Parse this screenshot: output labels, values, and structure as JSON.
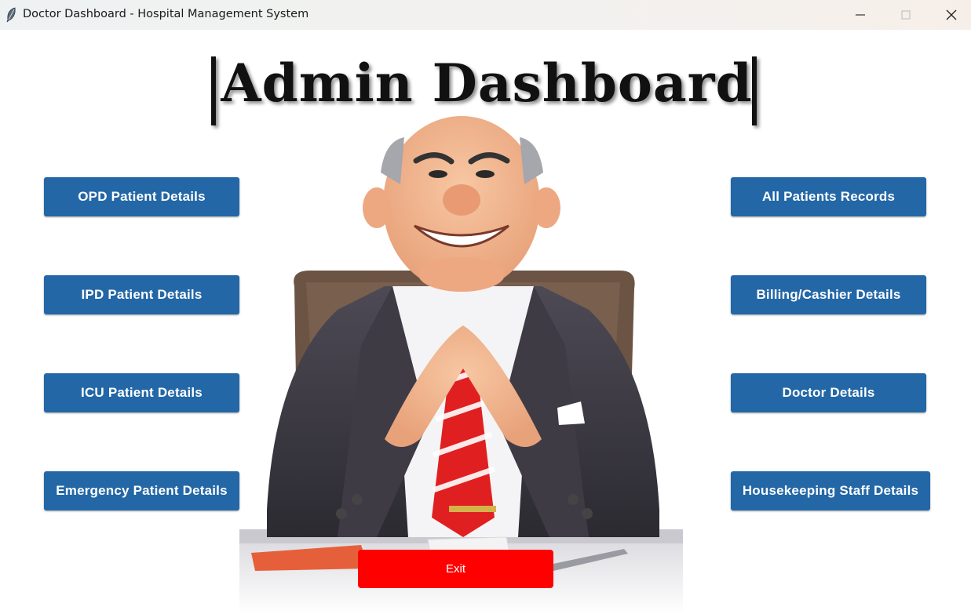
{
  "window": {
    "title": "Doctor Dashboard - Hospital Management System",
    "icon": "feather-icon",
    "controls": [
      "minimize-icon",
      "maximize-icon",
      "close-icon"
    ]
  },
  "header": {
    "title": "Admin Dashboard"
  },
  "left_buttons": [
    {
      "label": "OPD Patient Details"
    },
    {
      "label": "IPD Patient Details"
    },
    {
      "label": "ICU Patient Details"
    },
    {
      "label": "Emergency Patient Details"
    }
  ],
  "right_buttons": [
    {
      "label": "All Patients Records"
    },
    {
      "label": "Billing/Cashier Details"
    },
    {
      "label": "Doctor Details"
    },
    {
      "label": "Housekeeping Staff Details"
    }
  ],
  "exit_button": {
    "label": "Exit"
  },
  "colors": {
    "button_blue": "#2367a6",
    "exit_red": "#ff0000",
    "background": "#ffffff"
  }
}
